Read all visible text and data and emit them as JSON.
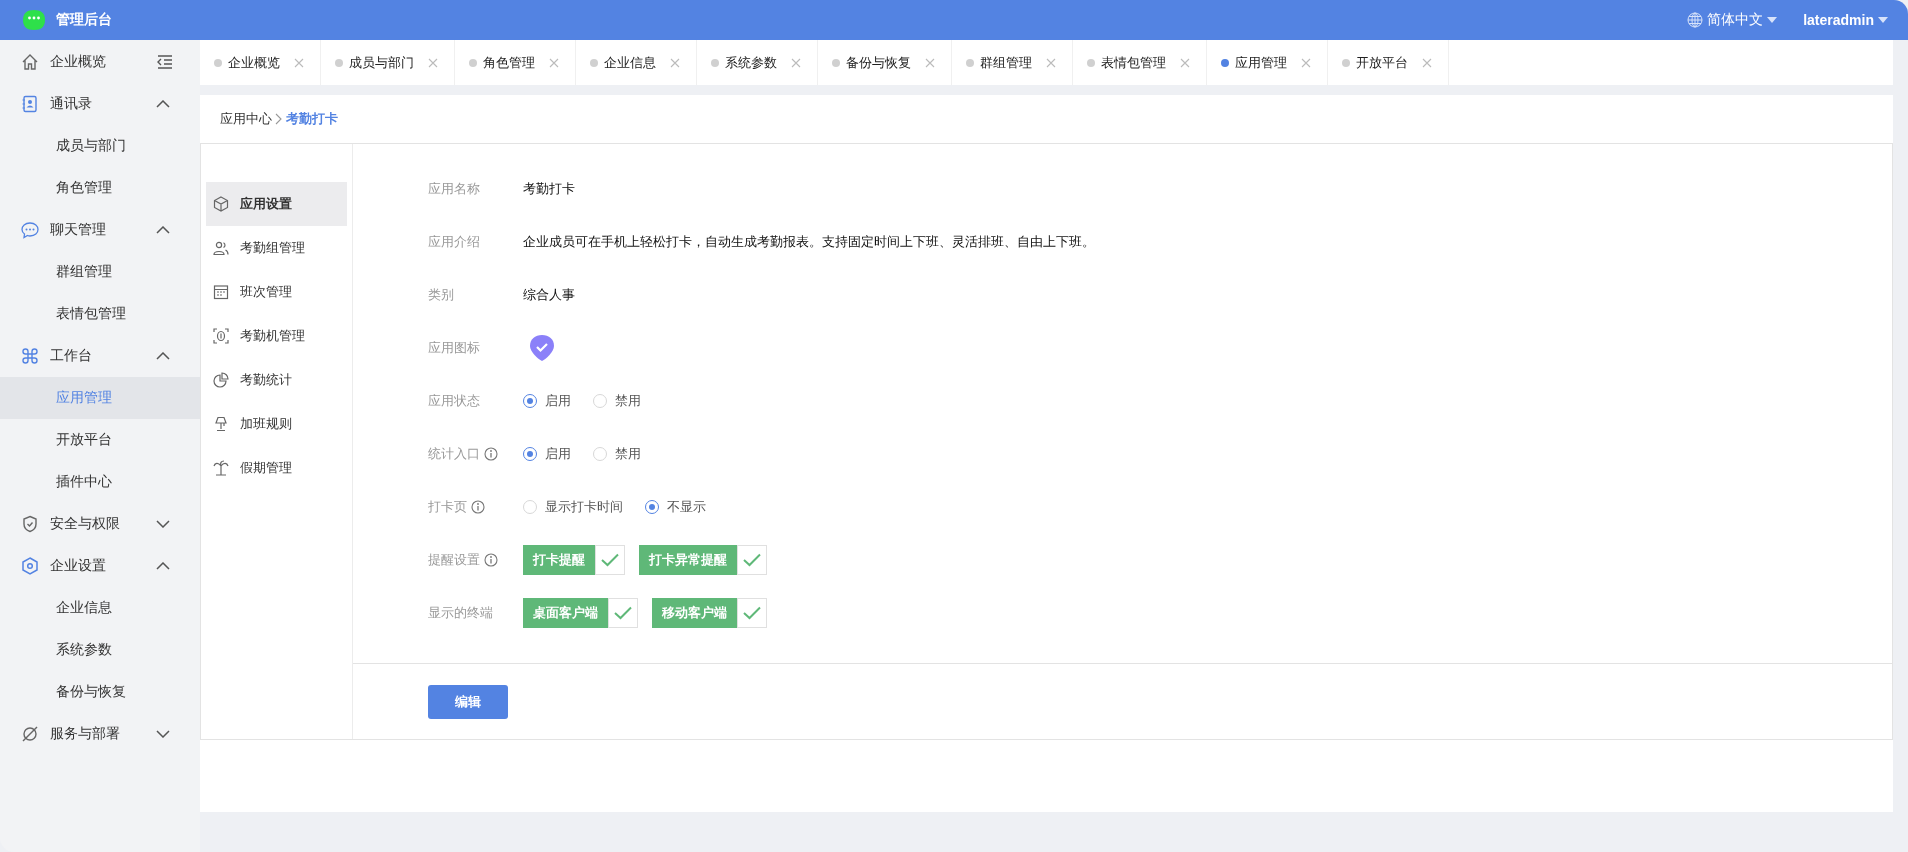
{
  "header": {
    "app_name": "管理后台",
    "language": "简体中文",
    "user": "lateradmin"
  },
  "sidebar": {
    "items": [
      {
        "label": "企业概览",
        "selected": false
      },
      {
        "label": "通讯录",
        "selected": false,
        "expanded": true,
        "children": [
          {
            "label": "成员与部门",
            "selected": false
          },
          {
            "label": "角色管理",
            "selected": false
          }
        ]
      },
      {
        "label": "聊天管理",
        "selected": false,
        "expanded": true,
        "children": [
          {
            "label": "群组管理",
            "selected": false
          },
          {
            "label": "表情包管理",
            "selected": false
          }
        ]
      },
      {
        "label": "工作台",
        "selected": false,
        "expanded": true,
        "children": [
          {
            "label": "应用管理",
            "selected": true
          },
          {
            "label": "开放平台",
            "selected": false
          },
          {
            "label": "插件中心",
            "selected": false
          }
        ]
      },
      {
        "label": "安全与权限",
        "selected": false,
        "expanded": false
      },
      {
        "label": "企业设置",
        "selected": false,
        "expanded": true,
        "children": [
          {
            "label": "企业信息",
            "selected": false
          },
          {
            "label": "系统参数",
            "selected": false
          },
          {
            "label": "备份与恢复",
            "selected": false
          }
        ]
      },
      {
        "label": "服务与部署",
        "selected": false,
        "expanded": false
      }
    ]
  },
  "tabs": [
    {
      "label": "企业概览",
      "selected": false
    },
    {
      "label": "成员与部门",
      "selected": false
    },
    {
      "label": "角色管理",
      "selected": false
    },
    {
      "label": "企业信息",
      "selected": false
    },
    {
      "label": "系统参数",
      "selected": false
    },
    {
      "label": "备份与恢复",
      "selected": false
    },
    {
      "label": "群组管理",
      "selected": false
    },
    {
      "label": "表情包管理",
      "selected": false
    },
    {
      "label": "应用管理",
      "selected": true
    },
    {
      "label": "开放平台",
      "selected": false
    }
  ],
  "breadcrumb": [
    "应用中心",
    "考勤打卡"
  ],
  "settings_menu": [
    {
      "label": "应用设置",
      "selected": true
    },
    {
      "label": "考勤组管理",
      "selected": false
    },
    {
      "label": "班次管理",
      "selected": false
    },
    {
      "label": "考勤机管理",
      "selected": false
    },
    {
      "label": "考勤统计",
      "selected": false
    },
    {
      "label": "加班规则",
      "selected": false
    },
    {
      "label": "假期管理",
      "selected": false
    }
  ],
  "form": [
    {
      "kind": "text",
      "label": "应用名称",
      "info": false,
      "value": "考勤打卡"
    },
    {
      "kind": "text",
      "label": "应用介绍",
      "info": false,
      "value": "企业成员可在手机上轻松打卡，自动生成考勤报表。支持固定时间上下班、灵活排班、自由上下班。"
    },
    {
      "kind": "text",
      "label": "类别",
      "info": false,
      "value": "综合人事"
    },
    {
      "kind": "icon",
      "label": "应用图标",
      "info": false
    },
    {
      "kind": "radio",
      "label": "应用状态",
      "info": false,
      "options": [
        {
          "label": "启用",
          "selected": true
        },
        {
          "label": "禁用",
          "selected": false
        }
      ]
    },
    {
      "kind": "radio",
      "label": "统计入口",
      "info": true,
      "options": [
        {
          "label": "启用",
          "selected": true
        },
        {
          "label": "禁用",
          "selected": false
        }
      ]
    },
    {
      "kind": "radio",
      "label": "打卡页",
      "info": true,
      "options": [
        {
          "label": "显示打卡时间",
          "selected": false
        },
        {
          "label": "不显示",
          "selected": true
        }
      ]
    },
    {
      "kind": "tags",
      "label": "提醒设置",
      "info": true,
      "tags": [
        {
          "label": "打卡提醒",
          "checked": true
        },
        {
          "label": "打卡异常提醒",
          "checked": true
        }
      ]
    },
    {
      "kind": "tags",
      "label": "显示的终端",
      "info": false,
      "tags": [
        {
          "label": "桌面客户端",
          "checked": true
        },
        {
          "label": "移动客户端",
          "checked": true
        }
      ]
    }
  ],
  "edit_button": "编辑"
}
